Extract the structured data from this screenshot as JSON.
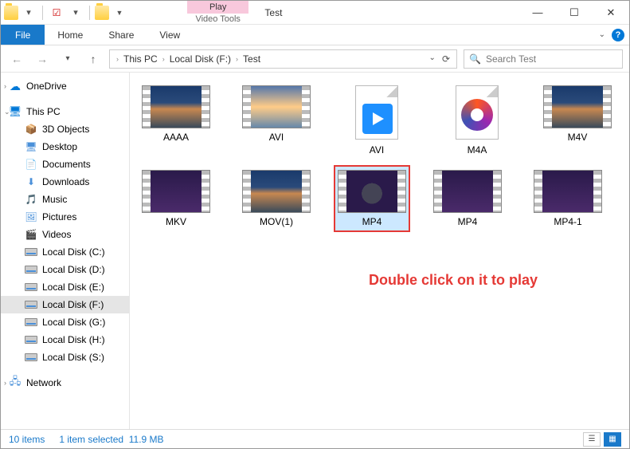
{
  "window": {
    "title": "Test",
    "tool_tab_top": "Play",
    "tool_tab_bottom": "Video Tools"
  },
  "ribbon": {
    "file": "File",
    "tabs": [
      "Home",
      "Share",
      "View"
    ]
  },
  "breadcrumbs": [
    "This PC",
    "Local Disk (F:)",
    "Test"
  ],
  "search": {
    "placeholder": "Search Test"
  },
  "sidebar": {
    "onedrive": "OneDrive",
    "thispc": "This PC",
    "items": [
      "3D Objects",
      "Desktop",
      "Documents",
      "Downloads",
      "Music",
      "Pictures",
      "Videos"
    ],
    "drives": [
      "Local Disk (C:)",
      "Local Disk (D:)",
      "Local Disk (E:)",
      "Local Disk (F:)",
      "Local Disk (G:)",
      "Local Disk (H:)",
      "Local Disk (S:)"
    ],
    "network": "Network"
  },
  "files": [
    {
      "name": "AAAA",
      "kind": "video",
      "style": "dusk"
    },
    {
      "name": "AVI",
      "kind": "video",
      "style": "sunset"
    },
    {
      "name": "AVI",
      "kind": "doc-play"
    },
    {
      "name": "M4A",
      "kind": "doc-disc"
    },
    {
      "name": "M4V",
      "kind": "video",
      "style": "dusk"
    },
    {
      "name": "MKV",
      "kind": "video",
      "style": "cartoon"
    },
    {
      "name": "MOV(1)",
      "kind": "video",
      "style": "dusk"
    },
    {
      "name": "MP4",
      "kind": "video",
      "style": "cartoon-face",
      "selected": true
    },
    {
      "name": "MP4",
      "kind": "video",
      "style": "cartoon"
    },
    {
      "name": "MP4-1",
      "kind": "video",
      "style": "cartoon"
    }
  ],
  "annotation": "Double click on it to play",
  "status": {
    "count": "10 items",
    "selected": "1 item selected",
    "size": "11.9 MB"
  }
}
